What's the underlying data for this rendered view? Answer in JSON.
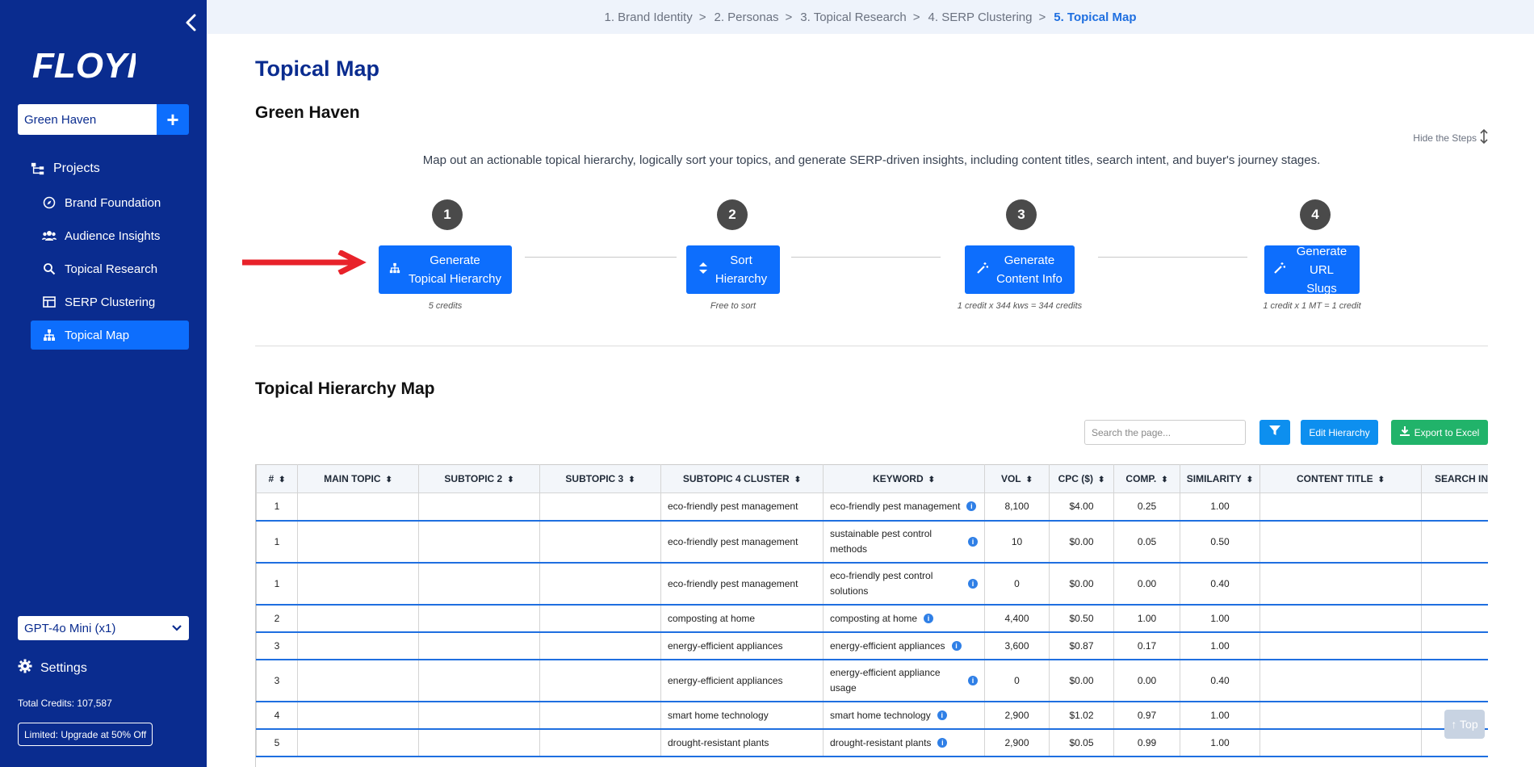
{
  "sidebar": {
    "logo_text": "FLOYI",
    "project": "Green Haven",
    "add_label": "+",
    "nav": [
      {
        "label": "Projects",
        "icon": "sitemap-icon"
      },
      {
        "label": "Brand Foundation",
        "icon": "compass-icon"
      },
      {
        "label": "Audience Insights",
        "icon": "users-icon"
      },
      {
        "label": "Topical Research",
        "icon": "search-icon"
      },
      {
        "label": "SERP Clustering",
        "icon": "table-icon"
      },
      {
        "label": "Topical Map",
        "icon": "hierarchy-icon"
      }
    ],
    "model": "GPT-4o Mini (x1)",
    "settings": "Settings",
    "credits": "Total Credits: 107,587",
    "upgrade": "Limited: Upgrade at 50% Off"
  },
  "breadcrumb": [
    "1. Brand Identity",
    "2. Personas",
    "3. Topical Research",
    "4. SERP Clustering",
    "5. Topical Map"
  ],
  "breadcrumb_sep": ">",
  "page": {
    "title": "Topical Map",
    "project_name": "Green Haven",
    "hide_steps": "Hide the Steps",
    "intro": "Map out an actionable topical hierarchy, logically sort your topics, and generate SERP-driven insights, including content titles, search intent, and buyer's journey stages."
  },
  "steps": [
    {
      "num": "1",
      "line1": "Generate",
      "line2": "Topical Hierarchy",
      "note": "5 credits"
    },
    {
      "num": "2",
      "line1": "Sort",
      "line2": "Hierarchy",
      "note": "Free to sort"
    },
    {
      "num": "3",
      "line1": "Generate",
      "line2": "Content Info",
      "note": "1 credit x 344 kws = 344 credits"
    },
    {
      "num": "4",
      "line1": "Generate",
      "line2": "URL Slugs",
      "note": "1 credit x 1 MT = 1 credit"
    }
  ],
  "map": {
    "title": "Topical Hierarchy Map",
    "search_placeholder": "Search the page...",
    "edit_label": "Edit Hierarchy",
    "export_label": "Export to Excel",
    "top_label": "↑ Top",
    "columns": [
      "#",
      "MAIN TOPIC",
      "SUBTOPIC 2",
      "SUBTOPIC 3",
      "SUBTOPIC 4 CLUSTER",
      "KEYWORD",
      "VOL",
      "CPC ($)",
      "COMP.",
      "SIMILARITY",
      "CONTENT TITLE",
      "SEARCH INT"
    ],
    "rows": [
      {
        "num": "1",
        "cluster": "eco-friendly pest management",
        "keyword": "eco-friendly pest management",
        "vol": "8,100",
        "cpc": "$4.00",
        "comp": "0.25",
        "sim": "1.00"
      },
      {
        "num": "1",
        "cluster": "eco-friendly pest management",
        "keyword": "sustainable pest control methods",
        "vol": "10",
        "cpc": "$0.00",
        "comp": "0.05",
        "sim": "0.50"
      },
      {
        "num": "1",
        "cluster": "eco-friendly pest management",
        "keyword": "eco-friendly pest control solutions",
        "vol": "0",
        "cpc": "$0.00",
        "comp": "0.00",
        "sim": "0.40"
      },
      {
        "num": "2",
        "cluster": "composting at home",
        "keyword": "composting at home",
        "vol": "4,400",
        "cpc": "$0.50",
        "comp": "1.00",
        "sim": "1.00"
      },
      {
        "num": "3",
        "cluster": "energy-efficient appliances",
        "keyword": "energy-efficient appliances",
        "vol": "3,600",
        "cpc": "$0.87",
        "comp": "0.17",
        "sim": "1.00"
      },
      {
        "num": "3",
        "cluster": "energy-efficient appliances",
        "keyword": "energy-efficient appliance usage",
        "vol": "0",
        "cpc": "$0.00",
        "comp": "0.00",
        "sim": "0.40"
      },
      {
        "num": "4",
        "cluster": "smart home technology",
        "keyword": "smart home technology",
        "vol": "2,900",
        "cpc": "$1.02",
        "comp": "0.97",
        "sim": "1.00"
      },
      {
        "num": "5",
        "cluster": "drought-resistant plants",
        "keyword": "drought-resistant plants",
        "vol": "2,900",
        "cpc": "$0.05",
        "comp": "0.99",
        "sim": "1.00"
      }
    ]
  },
  "colors": {
    "sidebar": "#0a2c8f",
    "primary": "#0d6efd",
    "export": "#21b36a",
    "arrow": "#e8222a"
  }
}
